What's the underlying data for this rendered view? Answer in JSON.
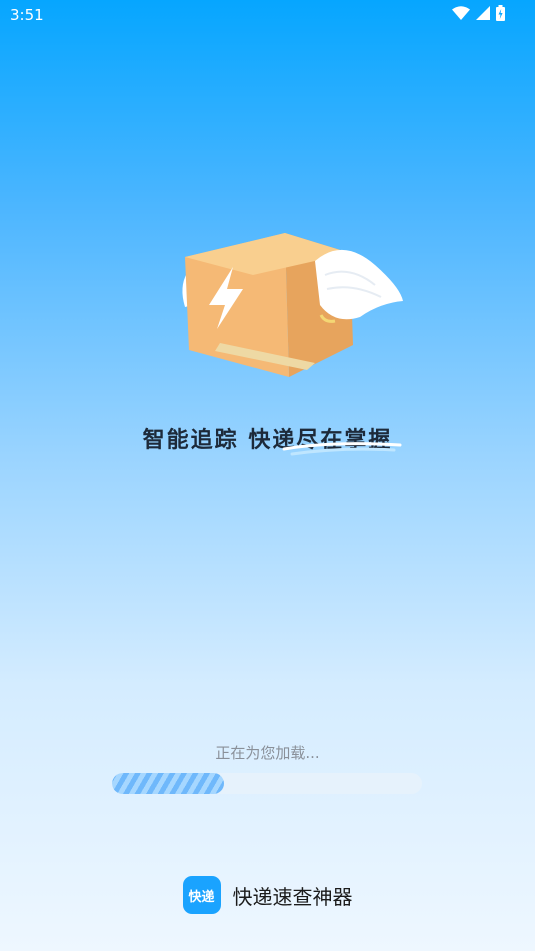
{
  "status_bar": {
    "time": "3:51",
    "icons": [
      "wifi-icon",
      "signal-icon",
      "battery-icon"
    ]
  },
  "hero": {
    "icon": "flying-box-icon"
  },
  "slogan": "智能追踪 快递尽在掌握",
  "loading": {
    "text": "正在为您加载...",
    "progress_fraction": 0.36
  },
  "app": {
    "logo_text": "快递",
    "name": "快递速查神器"
  },
  "colors": {
    "brand_blue": "#1aa3ff",
    "progress_fill": "#7ec3ff",
    "progress_track": "#e6f2fc",
    "slogan_text": "#1d2a3a"
  }
}
